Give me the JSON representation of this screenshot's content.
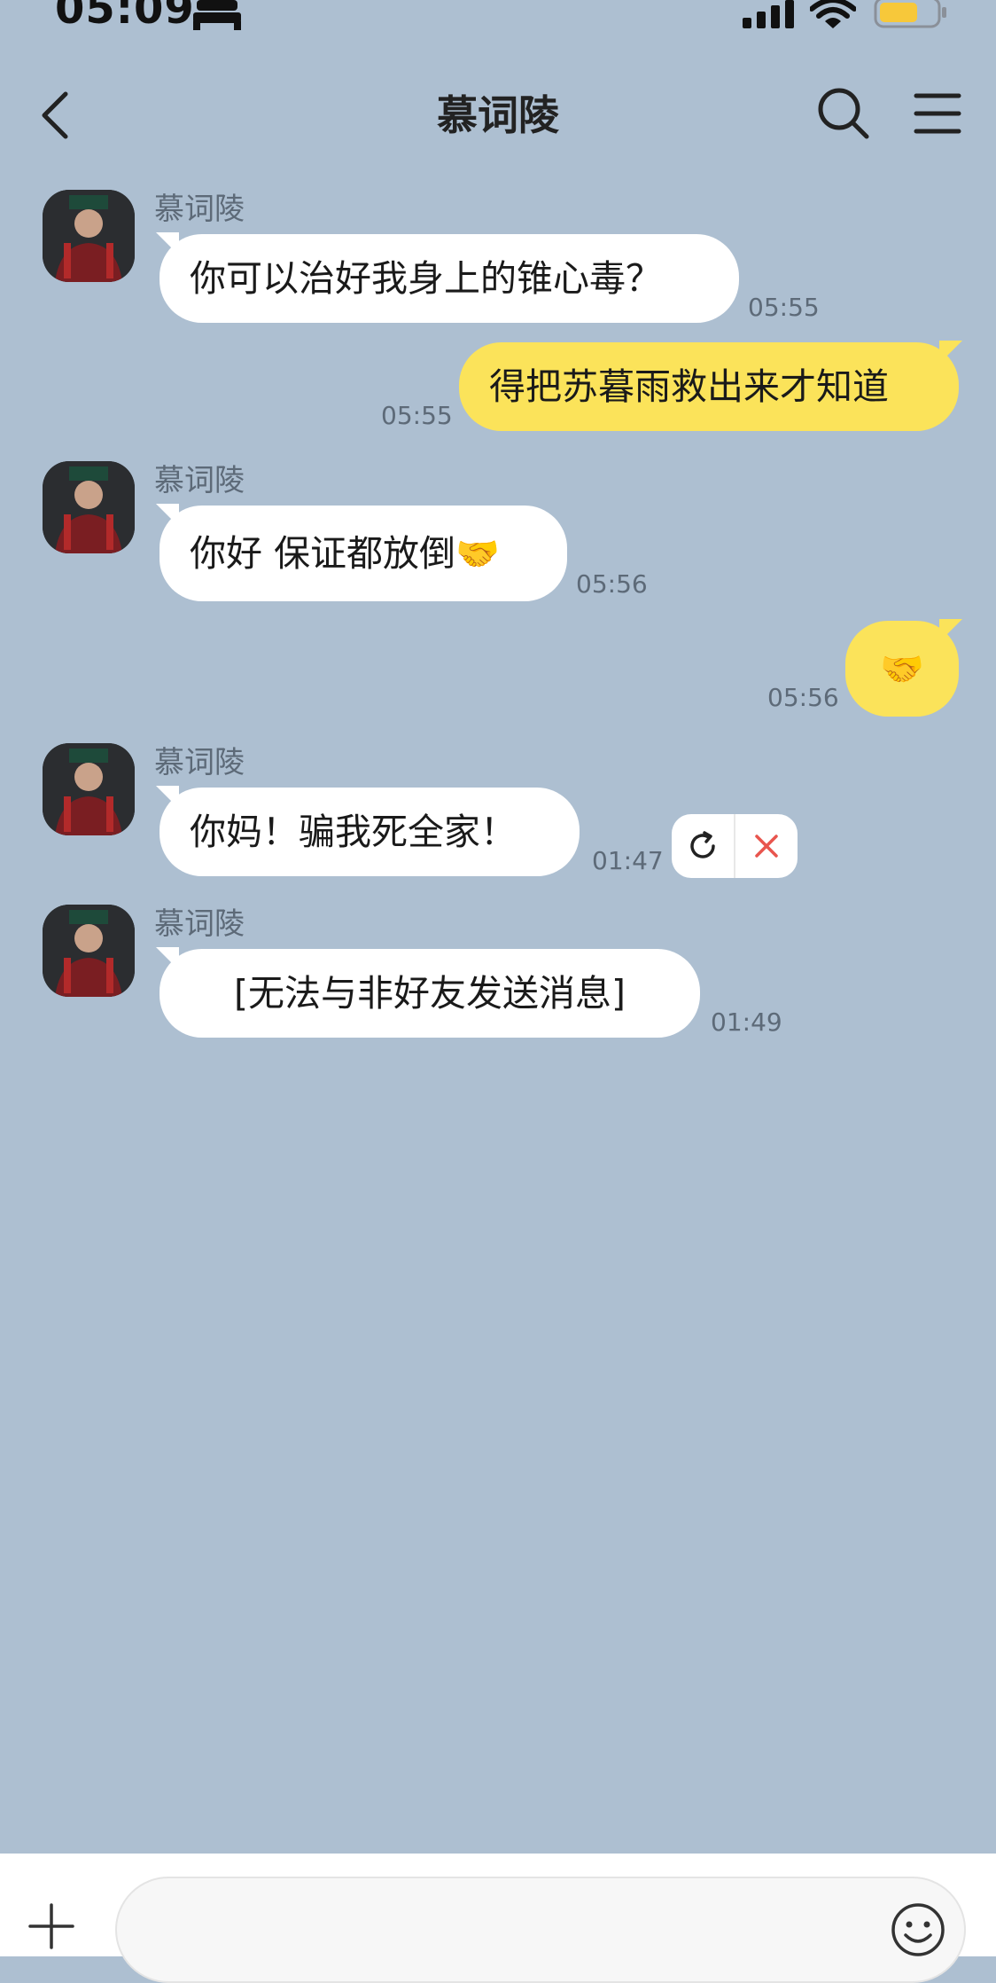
{
  "status_bar": {
    "time": "05:09"
  },
  "header": {
    "title": "慕词陵"
  },
  "messages": [
    {
      "sender": "慕词陵",
      "text": "你可以治好我身上的锥心毒？",
      "time": "05:55"
    },
    {
      "text": "得把苏暮雨救出来才知道",
      "time": "05:55"
    },
    {
      "sender": "慕词陵",
      "text": "你好 保证都放倒",
      "emoji": "🤝",
      "time": "05:56"
    },
    {
      "emoji": "🤝",
      "time": "05:56"
    },
    {
      "sender": "慕词陵",
      "text": "你妈！骗我死全家！",
      "time": "01:47"
    },
    {
      "sender": "慕词陵",
      "text": "[无法与非好友发送消息]",
      "time": "01:49"
    }
  ],
  "input": {
    "placeholder": ""
  },
  "colors": {
    "background": "#adbfd1",
    "outgoing_bubble": "#fbe35a",
    "incoming_bubble": "#ffffff",
    "cancel_red": "#e8554e"
  },
  "icons": [
    "back-arrow-icon",
    "search-icon",
    "menu-icon",
    "retry-icon",
    "close-icon",
    "plus-icon",
    "emoji-smile-icon",
    "bed-icon",
    "signal-icon",
    "wifi-icon",
    "battery-icon"
  ]
}
